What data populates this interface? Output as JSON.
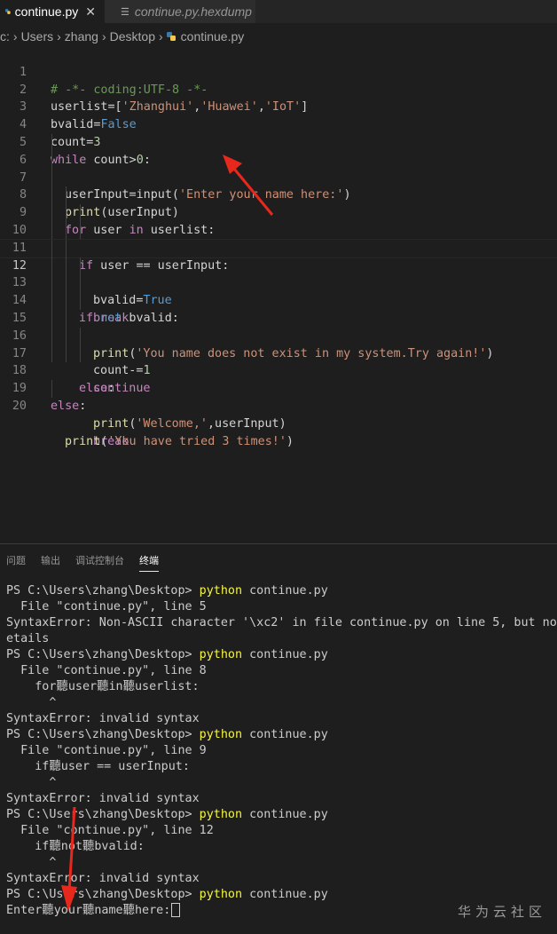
{
  "tabs": [
    {
      "label": "continue.py",
      "active": true
    },
    {
      "label": "continue.py.hexdump",
      "active": false
    }
  ],
  "breadcrumb": [
    "c:",
    "Users",
    "zhang",
    "Desktop",
    "continue.py"
  ],
  "code_lines": [
    "1",
    "2",
    "3",
    "4",
    "5",
    "6",
    "7",
    "8",
    "9",
    "10",
    "11",
    "12",
    "13",
    "14",
    "15",
    "16",
    "17",
    "18",
    "19",
    "20"
  ],
  "code": {
    "l1": "# -*- coding:UTF-8 -*-",
    "l2a": "userlist=[",
    "l2b": "'Zhanghui'",
    "l2c": ",",
    "l2d": "'Huawei'",
    "l2e": ",",
    "l2f": "'IoT'",
    "l2g": "]",
    "l3a": "bvalid=",
    "l3b": "False",
    "l4a": "count=",
    "l4b": "3",
    "l5a": "while",
    "l5b": " count>",
    "l5c": "0",
    "l5d": ":",
    "l6a": "userInput=input(",
    "l6b": "'Enter your name here:'",
    "l6c": ")",
    "l7a": "print",
    "l7b": "(userInput)",
    "l8a": "for",
    "l8b": " user ",
    "l8c": "in",
    "l8d": " userlist:",
    "l9a": "if",
    "l9b": " user == userInput:",
    "l10a": "bvalid=",
    "l10b": "True",
    "l11": "break",
    "l12a": "if",
    "l12b": " ",
    "l12c": "not",
    "l12d": " bvalid:",
    "l13a": "print",
    "l13b": "(",
    "l13c": "'You name does not exist in my system.Try again!'",
    "l13d": ")",
    "l14a": "count-=",
    "l14b": "1",
    "l15": "continue",
    "l16a": "else",
    "l16b": ":",
    "l17a": "print",
    "l17b": "(",
    "l17c": "'Welcome,'",
    "l17d": ",userInput)",
    "l18": "break",
    "l19a": "else",
    "l19b": ":",
    "l20a": "print",
    "l20b": "(",
    "l20c": "'You have tried 3 times!'",
    "l20d": ")"
  },
  "panel_tabs": [
    "问题",
    "输出",
    "调试控制台",
    "终端"
  ],
  "terminal": {
    "prompt": "PS C:\\Users\\zhang\\Desktop> ",
    "cmd": "python",
    "arg": " continue.py",
    "t2": "  File \"continue.py\", line 5",
    "t3": "SyntaxError: Non-ASCII character '\\xc2' in file continue.py on line 5, but no",
    "t4": "etails",
    "t6": "  File \"continue.py\", line 8",
    "t7": "    for聽user聽in聽userlist:",
    "t8": "      ^",
    "t9": "SyntaxError: invalid syntax",
    "t11": "  File \"continue.py\", line 9",
    "t12": "    if聽user == userInput:",
    "t13": "      ^",
    "t14": "SyntaxError: invalid syntax",
    "t16": "  File \"continue.py\", line 12",
    "t17": "    if聽not聽bvalid:",
    "t18": "      ^",
    "t19": "SyntaxError: invalid syntax",
    "t21": "Enter聽your聽name聽here:"
  },
  "watermark": "华为云社区",
  "colors": {
    "background": "#1e1e1e",
    "keyword": "#569cd6",
    "string": "#ce9178",
    "command": "#f5f543",
    "arrow": "#e8281c"
  }
}
